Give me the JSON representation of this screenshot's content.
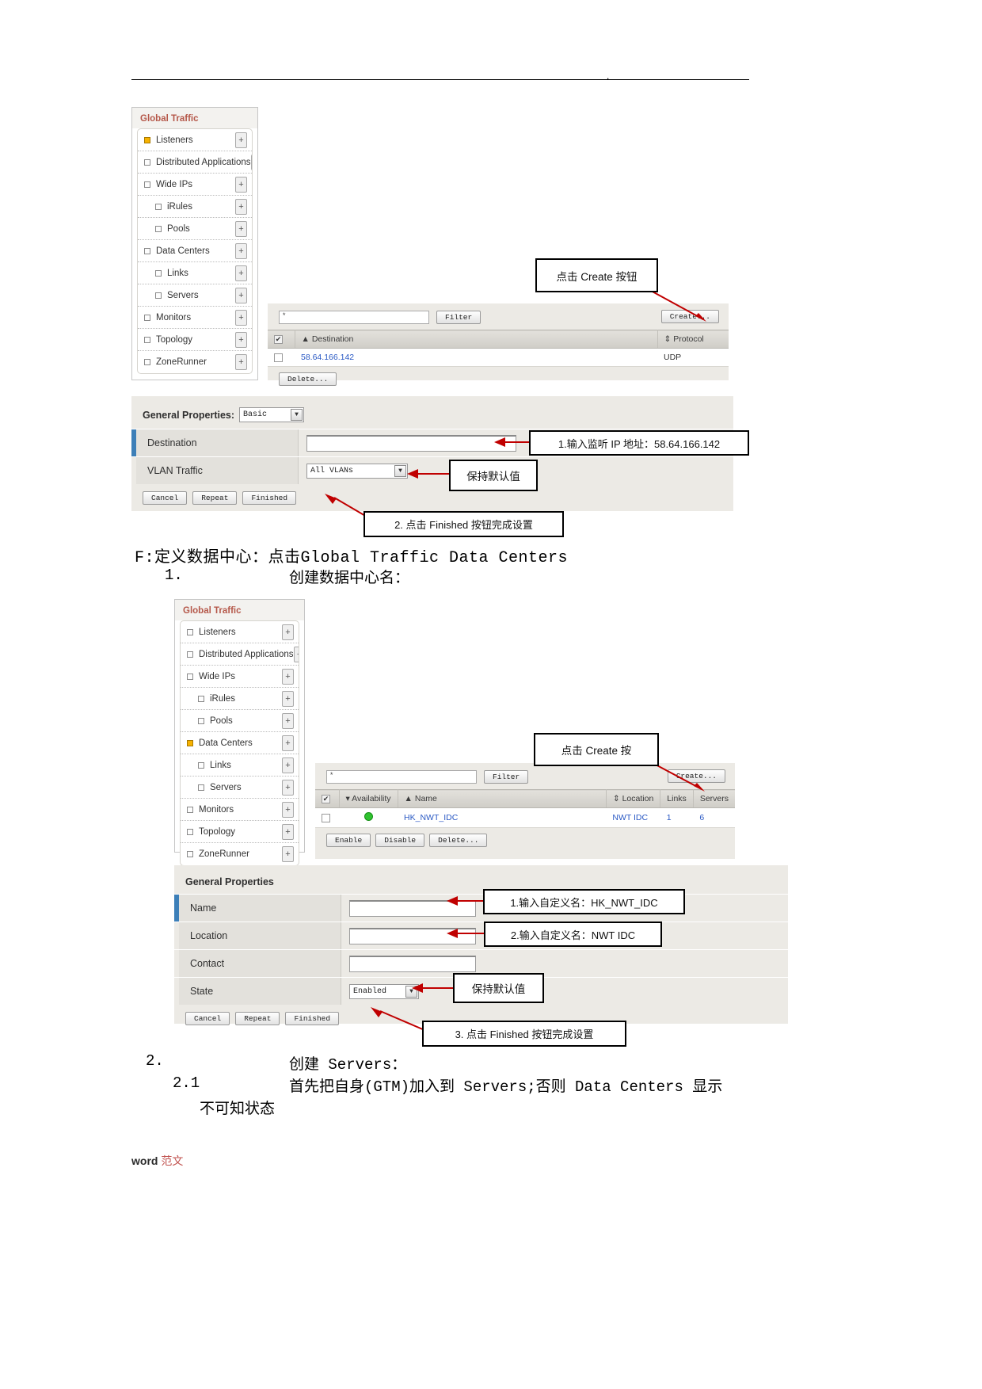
{
  "page": {
    "header_dot": ".",
    "footer_word": "word",
    "footer_cn": "范文"
  },
  "nav_panel_1": {
    "title": "Global Traffic",
    "items": [
      {
        "label": "Listeners",
        "selected": true,
        "indent": false,
        "plus": "+"
      },
      {
        "label": "Distributed Applications",
        "selected": false,
        "indent": false,
        "plus": "+"
      },
      {
        "label": "Wide IPs",
        "selected": false,
        "indent": false,
        "plus": "+"
      },
      {
        "label": "iRules",
        "selected": false,
        "indent": true,
        "plus": "+"
      },
      {
        "label": "Pools",
        "selected": false,
        "indent": true,
        "plus": "+"
      },
      {
        "label": "Data Centers",
        "selected": false,
        "indent": false,
        "plus": "+"
      },
      {
        "label": "Links",
        "selected": false,
        "indent": true,
        "plus": "+"
      },
      {
        "label": "Servers",
        "selected": false,
        "indent": true,
        "plus": "+"
      },
      {
        "label": "Monitors",
        "selected": false,
        "indent": false,
        "plus": "+"
      },
      {
        "label": "Topology",
        "selected": false,
        "indent": false,
        "plus": "+"
      },
      {
        "label": "ZoneRunner",
        "selected": false,
        "indent": false,
        "plus": "+"
      }
    ]
  },
  "listeners_list": {
    "filter_value": "*",
    "filter_button": "Filter",
    "create_button": "Create...",
    "columns": [
      "Destination",
      "Protocol"
    ],
    "rows": [
      {
        "destination": "58.64.166.142",
        "protocol": "UDP"
      }
    ],
    "delete_button": "Delete..."
  },
  "listener_form": {
    "heading": "General Properties:",
    "mode_value": "Basic",
    "fields": [
      {
        "label": "Destination",
        "type": "text",
        "value": ""
      },
      {
        "label": "VLAN Traffic",
        "type": "select",
        "value": "All VLANs"
      }
    ],
    "buttons": [
      "Cancel",
      "Repeat",
      "Finished"
    ]
  },
  "callouts_section_1": {
    "create": "点击 Create 按钮",
    "destination_ip": "1.输入监听 IP 地址：58.64.166.142",
    "keep_default": "保持默认值",
    "finished": "2. 点击 Finished 按钮完成设置"
  },
  "body_text": {
    "line_f": "F:定义数据中心：点击Global Traffic Data Centers",
    "line_1_num": "1.",
    "line_1_text": "创建数据中心名：",
    "line_2_num": "2.",
    "line_2_text": "创建 Servers：",
    "line_21_num": "2.1",
    "line_21_text": "首先把自身(GTM)加入到 Servers;否则 Data Centers 显示",
    "line_21_cont": "不可知状态"
  },
  "nav_panel_2": {
    "title": "Global Traffic",
    "items": [
      {
        "label": "Listeners",
        "selected": false,
        "indent": false,
        "plus": "+"
      },
      {
        "label": "Distributed Applications",
        "selected": false,
        "indent": false,
        "plus": "+"
      },
      {
        "label": "Wide IPs",
        "selected": false,
        "indent": false,
        "plus": "+"
      },
      {
        "label": "iRules",
        "selected": false,
        "indent": true,
        "plus": "+"
      },
      {
        "label": "Pools",
        "selected": false,
        "indent": true,
        "plus": "+"
      },
      {
        "label": "Data Centers",
        "selected": true,
        "indent": false,
        "plus": "+"
      },
      {
        "label": "Links",
        "selected": false,
        "indent": true,
        "plus": "+"
      },
      {
        "label": "Servers",
        "selected": false,
        "indent": true,
        "plus": "+"
      },
      {
        "label": "Monitors",
        "selected": false,
        "indent": false,
        "plus": "+"
      },
      {
        "label": "Topology",
        "selected": false,
        "indent": false,
        "plus": "+"
      },
      {
        "label": "ZoneRunner",
        "selected": false,
        "indent": false,
        "plus": "+"
      }
    ]
  },
  "datacenters_list": {
    "filter_value": "*",
    "filter_button": "Filter",
    "create_button": "Create...",
    "columns": [
      "Availability",
      "Name",
      "Location",
      "Links",
      "Servers"
    ],
    "rows": [
      {
        "availability": "green",
        "name": "HK_NWT_IDC",
        "location": "NWT IDC",
        "links": "1",
        "servers": "6"
      }
    ],
    "buttons": [
      "Enable",
      "Disable",
      "Delete..."
    ]
  },
  "datacenter_form": {
    "heading": "General Properties",
    "fields": [
      {
        "label": "Name",
        "type": "text",
        "value": ""
      },
      {
        "label": "Location",
        "type": "text",
        "value": ""
      },
      {
        "label": "Contact",
        "type": "text",
        "value": ""
      },
      {
        "label": "State",
        "type": "select",
        "value": "Enabled"
      }
    ],
    "buttons": [
      "Cancel",
      "Repeat",
      "Finished"
    ]
  },
  "callouts_section_2": {
    "create": "点击 Create 按",
    "name": "1.输入自定义名：HK_NWT_IDC",
    "location": "2.输入自定义名：NWT IDC",
    "keep_default": "保持默认值",
    "finished": "3. 点击 Finished 按钮完成设置"
  },
  "colors": {
    "nav_title": "#b5584a",
    "link": "#2a59c4",
    "accent_bar": "#3d7fb8",
    "status_green": "#2fc22f",
    "arrow_red": "#c00000",
    "selected_square": "#f7b200"
  }
}
